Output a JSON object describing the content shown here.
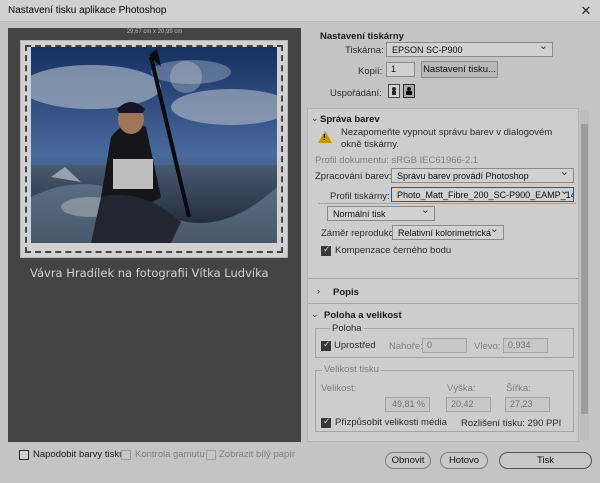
{
  "window": {
    "title": "Nastavení tisku aplikace Photoshop",
    "close_glyph": "✕"
  },
  "preview": {
    "dimensions": "29,67 cm x 20,99 cm",
    "caption": "Vávra Hradílek na fotografii Vítka Ludvíka"
  },
  "printer_settings": {
    "header": "Nastavení tiskárny",
    "printer_label": "Tiskárna:",
    "printer_value": "EPSON SC-P900",
    "copies_label": "Kopií:",
    "copies_value": "1",
    "print_settings_button": "Nastavení tisku...",
    "layout_label": "Uspořádání:",
    "layout_icons": [
      "portrait-icon",
      "landscape-icon"
    ]
  },
  "color_management": {
    "header": "Správa barev",
    "warning": "Nezapomeňte vypnout správu barev v dialogovém okně tiskárny.",
    "document_profile": "Profil dokumentu: sRGB IEC61966-2.1",
    "color_handling_label": "Zpracování barev:",
    "color_handling_value": "Správu barev provádí Photoshop",
    "printer_profile_label": "Profil tiskárny:",
    "printer_profile_value": "Photo_Matt_Fibre_200_SC-P900_EAMP_1440...",
    "print_mode_value": "Normální tisk",
    "rendering_intent_label": "Záměr reprodukce:",
    "rendering_intent_value": "Relativní kolorimetrická",
    "black_point_label": "Kompenzace černého bodu",
    "black_point_checked": true
  },
  "marks": {
    "header": "Popis"
  },
  "position_size": {
    "header": "Poloha a velikost",
    "position_group": "Poloha",
    "center_label": "Uprostřed",
    "center_checked": true,
    "top_label": "Nahoře:",
    "top_value": "0",
    "left_label": "Vlevo:",
    "left_value": "0,934",
    "scaled_group": "Velikost tisku",
    "scale_label": "Velikost:",
    "scale_value": "49,81 %",
    "height_label": "Výška:",
    "height_value": "20,42",
    "width_label": "Šířka:",
    "width_value": "27,23",
    "fit_label": "Přizpůsobit velikosti média",
    "fit_checked": true,
    "resolution": "Rozlišení tisku: 290 PPI"
  },
  "bottom": {
    "match_colors": "Napodobit barvy tisku",
    "gamut_warning": "Kontrola gamutu",
    "show_white": "Zobrazit bílý papír",
    "cancel": "Obnovit",
    "done": "Hotovo",
    "print": "Tisk"
  },
  "colors": {
    "preview_bg": "#535353",
    "accent": "#0078d7",
    "warning": "#f5b400"
  }
}
